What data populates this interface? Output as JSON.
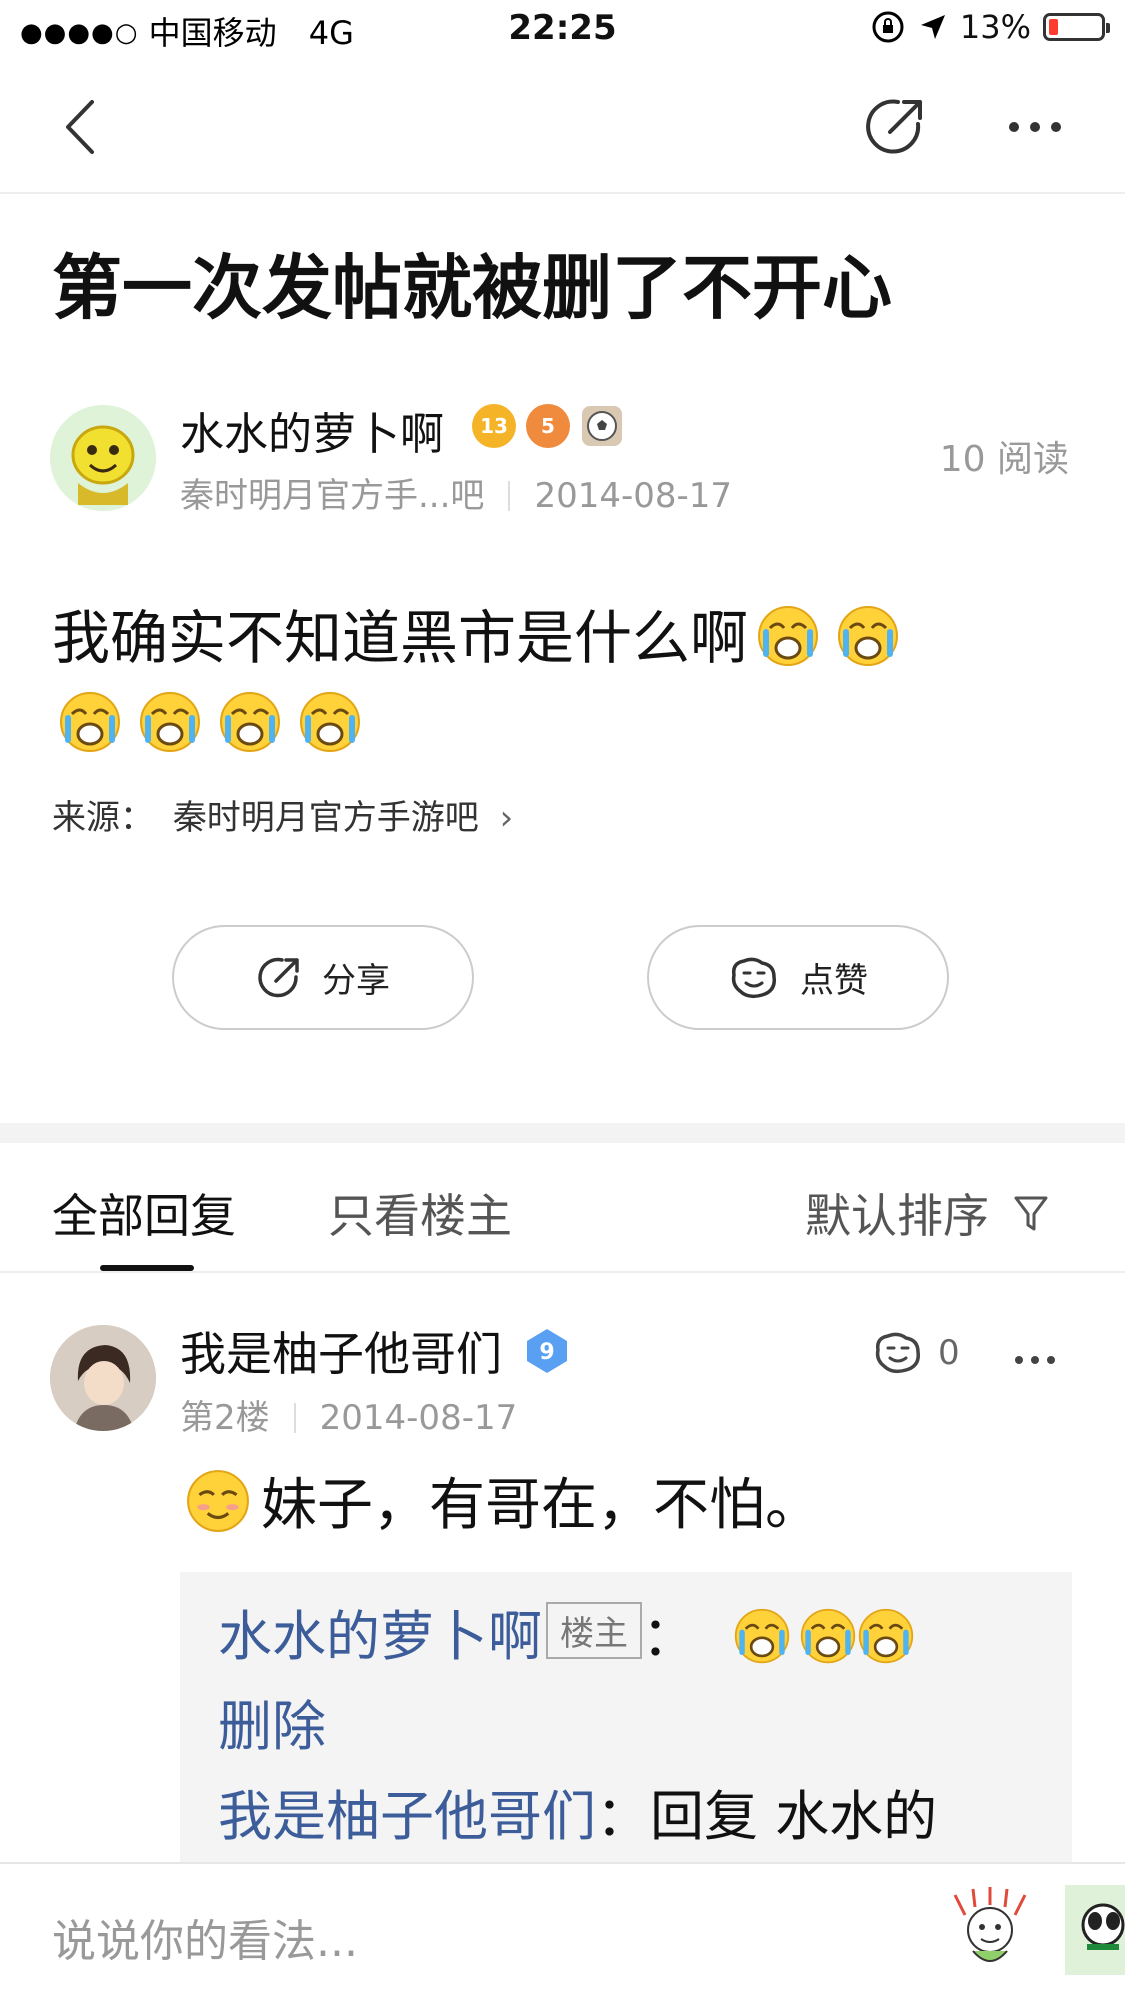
{
  "status_bar": {
    "signal": "●●●●○",
    "carrier": "中国移动",
    "network": "4G",
    "time": "22:25",
    "battery": "13%",
    "battery_level": 0.13
  },
  "post": {
    "title": "第一次发帖就被删了不开心",
    "author": "水水的萝卜啊",
    "level_badge": "13",
    "badge2": "5",
    "forum_short": "秦时明月官方手...吧",
    "date": "2014-08-17",
    "reads": "10 阅读",
    "body_text": "我确实不知道黑市是什么啊",
    "source_label": "来源：",
    "source_name": "秦时明月官方手游吧",
    "source_chevron": "›"
  },
  "actions": {
    "share_label": "分享",
    "like_label": "点赞"
  },
  "tabs": {
    "all": "全部回复",
    "op_only": "只看楼主",
    "sort": "默认排序"
  },
  "reply": {
    "name": "我是柚子他哥们",
    "level": "9",
    "floor": "第2楼",
    "date": "2014-08-17",
    "likes": "0",
    "content": "妹子，有哥在，不怕。",
    "sub_replies": [
      {
        "name": "水水的萝卜啊",
        "tag": "楼主",
        "colon": "：",
        "text": ""
      },
      {
        "name": "删除",
        "tag": "",
        "colon": "",
        "text": ""
      },
      {
        "name": "我是柚子他哥们",
        "tag": "",
        "colon": "：",
        "text": "回复 水水的"
      }
    ]
  },
  "bottom": {
    "comment_placeholder": "说说你的看法..."
  },
  "colors": {
    "link_blue": "#3c5d9a",
    "battery_red": "#ff3b30",
    "level_gold": "#f5b428",
    "level_blue": "#5aa0f2"
  },
  "icons": [
    "back-icon",
    "share-icon",
    "more-icon",
    "crying-emoji-icon",
    "smug-emoji-icon",
    "like-hand-icon",
    "filter-icon",
    "sticker-icon"
  ]
}
